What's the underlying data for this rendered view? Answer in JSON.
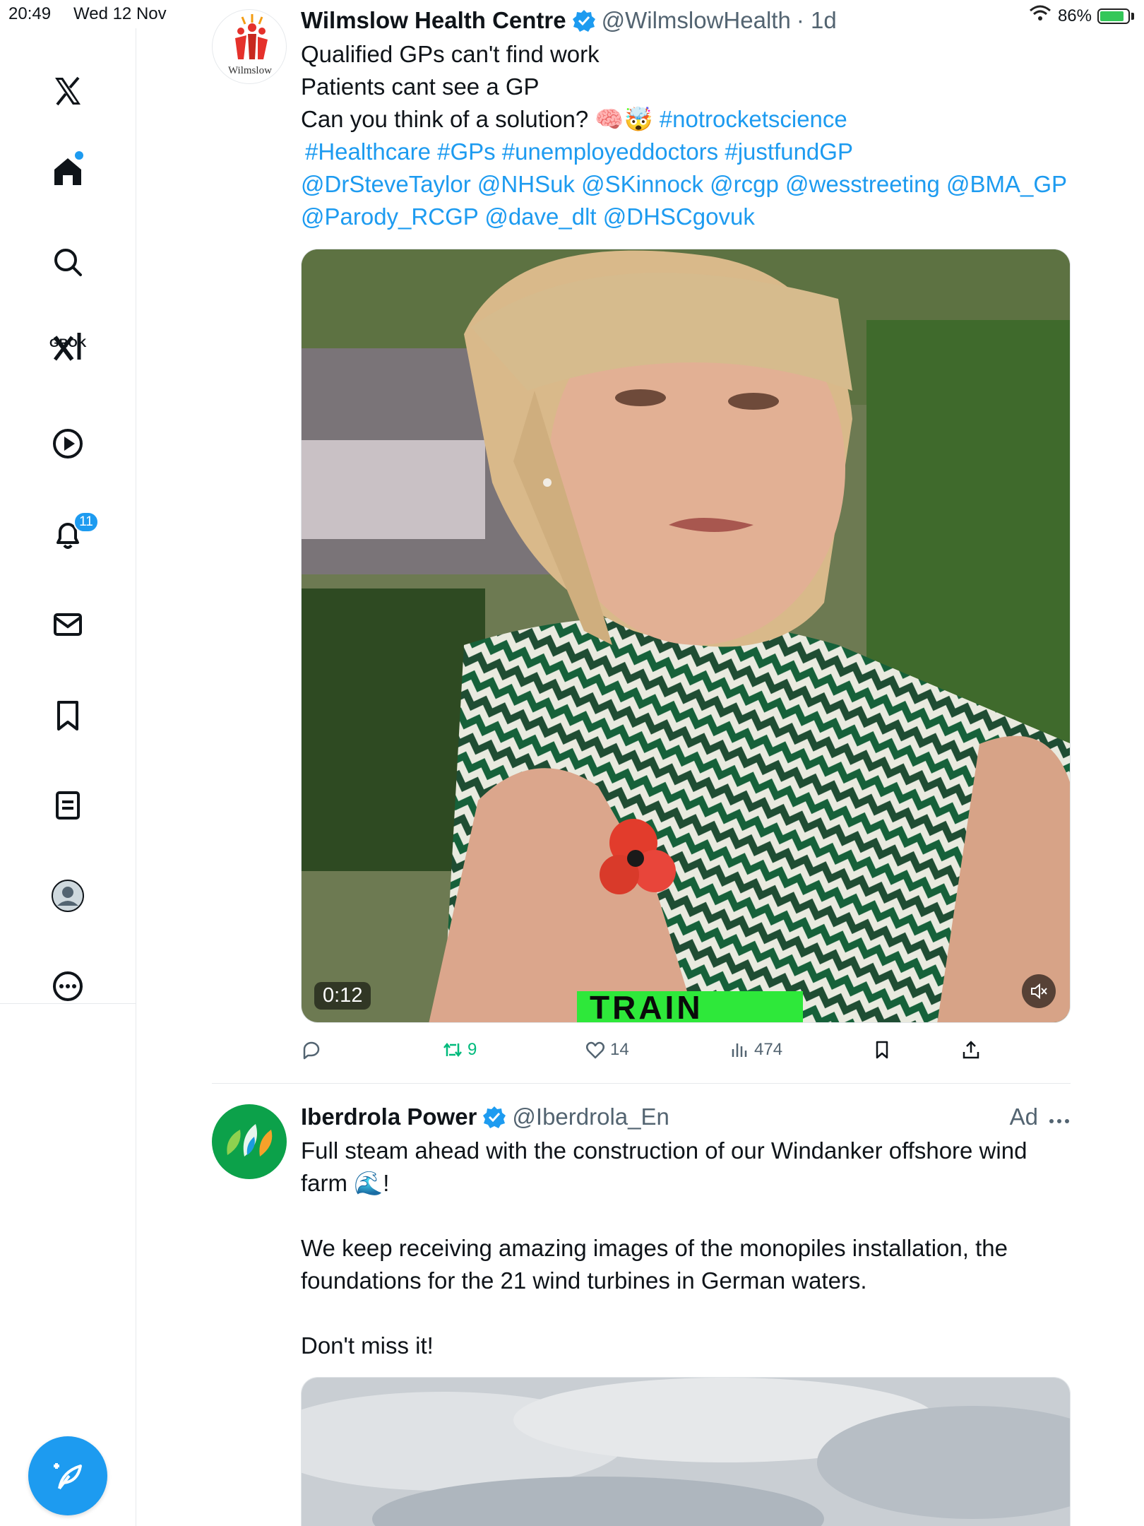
{
  "status_bar": {
    "time": "20:49",
    "date": "Wed 12 Nov",
    "battery": "86%"
  },
  "sidebar": {
    "grok_label": "GROK",
    "notifications_count": "11"
  },
  "tweets": [
    {
      "name": "Wilmslow Health Centre",
      "handle": "@WilmslowHealth",
      "time": "· 1d",
      "avatar_text": "Wilmslow",
      "lines": [
        "Qualified GPs can't find work",
        "Patients cant see a GP",
        "Can you think of a solution? 🧠🤯"
      ],
      "hashtag_inline": "#notrocketscience",
      "hashtags": "#Healthcare #GPs #unemployeddoctors #justfundGP",
      "mentions_1": "@DrSteveTaylor @NHSuk @SKinnock @rcgp @wesstreeting @BMA_GP",
      "mentions_2": "@Parody_RCGP @dave_dlt @DHSCgovuk",
      "video_duration": "0:12",
      "video_caption": "TRAIN",
      "retweets": "9",
      "likes": "14",
      "views": "474"
    },
    {
      "name": "Iberdrola Power",
      "handle": "@Iberdrola_En",
      "ad_label": "Ad",
      "text_1": "Full steam ahead with the construction of our Windanker offshore wind",
      "text_2": "farm 🌊!",
      "text_3": "We keep receiving amazing images of the monopiles installation, the",
      "text_4": "foundations for the 21 wind turbines in German waters.",
      "text_5": "Don't miss it!"
    }
  ],
  "colors": {
    "accent": "#1d9bf0",
    "retweet_green": "#00ba7c",
    "text_primary": "#0f1419",
    "text_secondary": "#536471"
  }
}
